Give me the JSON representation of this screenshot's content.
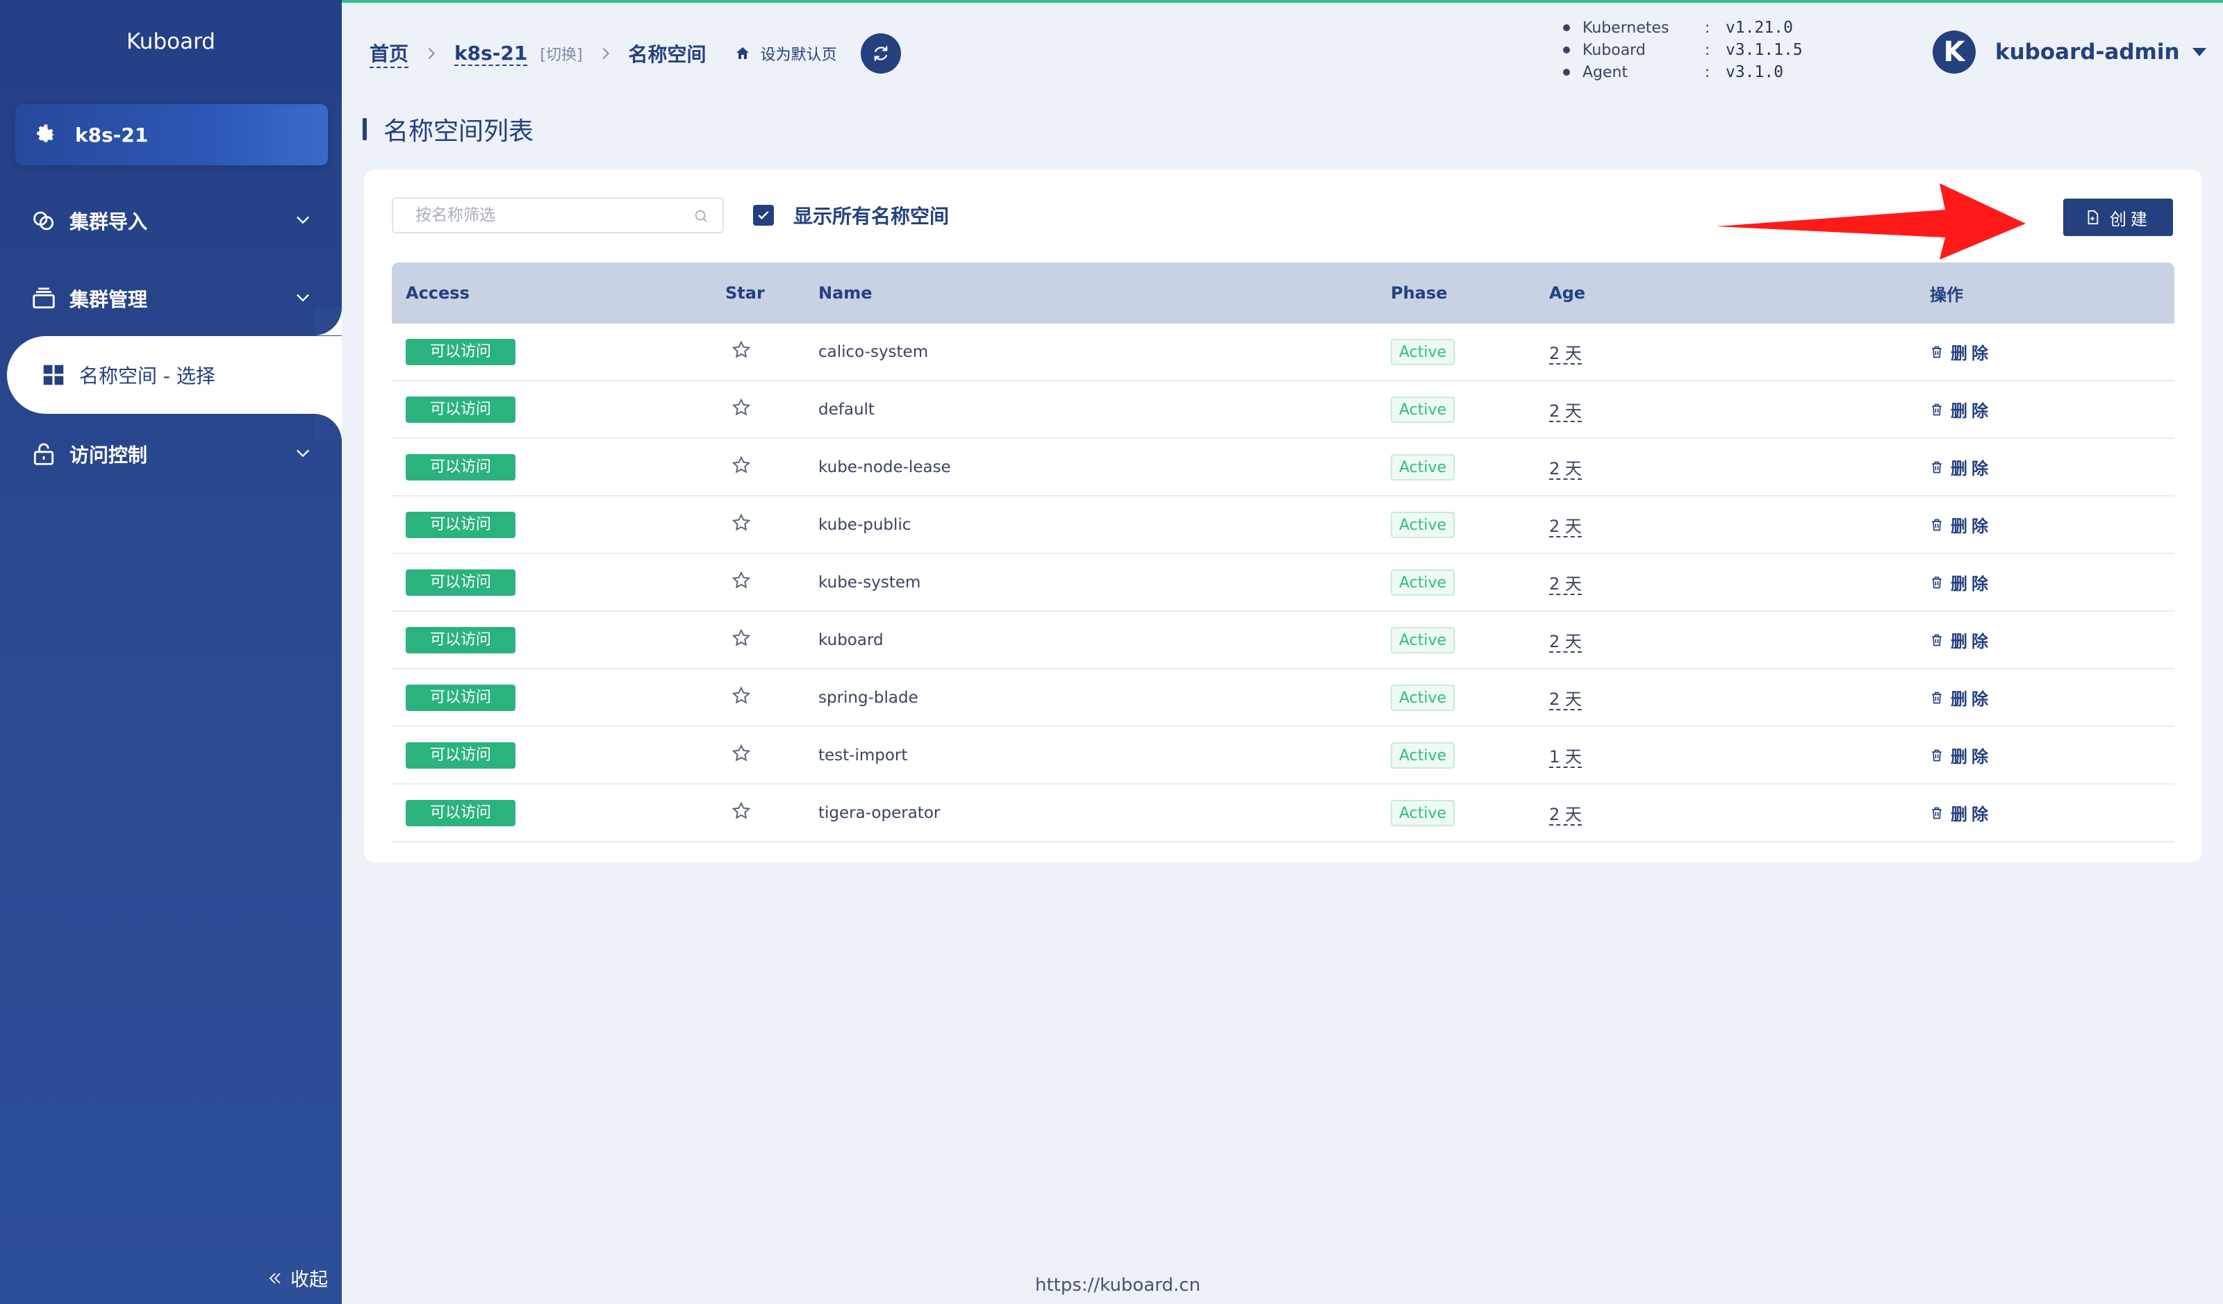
{
  "app": {
    "brand": "Kuboard"
  },
  "sidebar": {
    "cluster": "k8s-21",
    "items": [
      {
        "label": "集群导入",
        "icon": "cluster-import-icon"
      },
      {
        "label": "集群管理",
        "icon": "cluster-manage-icon"
      },
      {
        "label": "名称空间 - 选择",
        "icon": "grid-icon"
      },
      {
        "label": "访问控制",
        "icon": "lock-icon"
      }
    ],
    "collapse": "收起"
  },
  "breadcrumb": {
    "home": "首页",
    "cluster": "k8s-21",
    "switch": "[切换]",
    "current": "名称空间",
    "set_default": "设为默认页"
  },
  "versions": [
    {
      "name": "Kubernetes",
      "sep": ":",
      "value": "v1.21.0"
    },
    {
      "name": "Kuboard",
      "sep": ":",
      "value": "v3.1.1.5"
    },
    {
      "name": "Agent",
      "sep": ":",
      "value": "v3.1.0"
    }
  ],
  "user": {
    "initial": "K",
    "name": "kuboard-admin"
  },
  "page": {
    "title": "名称空间列表"
  },
  "toolbar": {
    "search_placeholder": "按名称筛选",
    "show_all_label": "显示所有名称空间",
    "create_label": "创建"
  },
  "table": {
    "headers": {
      "access": "Access",
      "star": "Star",
      "name": "Name",
      "phase": "Phase",
      "age": "Age",
      "ops": "操作"
    },
    "rows": [
      {
        "access": "可以访问",
        "name": "calico-system",
        "phase": "Active",
        "age": "2 天",
        "op": "删除"
      },
      {
        "access": "可以访问",
        "name": "default",
        "phase": "Active",
        "age": "2 天",
        "op": "删除"
      },
      {
        "access": "可以访问",
        "name": "kube-node-lease",
        "phase": "Active",
        "age": "2 天",
        "op": "删除"
      },
      {
        "access": "可以访问",
        "name": "kube-public",
        "phase": "Active",
        "age": "2 天",
        "op": "删除"
      },
      {
        "access": "可以访问",
        "name": "kube-system",
        "phase": "Active",
        "age": "2 天",
        "op": "删除"
      },
      {
        "access": "可以访问",
        "name": "kuboard",
        "phase": "Active",
        "age": "2 天",
        "op": "删除"
      },
      {
        "access": "可以访问",
        "name": "spring-blade",
        "phase": "Active",
        "age": "2 天",
        "op": "删除"
      },
      {
        "access": "可以访问",
        "name": "test-import",
        "phase": "Active",
        "age": "1 天",
        "op": "删除"
      },
      {
        "access": "可以访问",
        "name": "tigera-operator",
        "phase": "Active",
        "age": "2 天",
        "op": "删除"
      }
    ]
  },
  "footer": {
    "url": "https://kuboard.cn"
  },
  "colors": {
    "primary": "#24407f",
    "sidebar": "#2a4990",
    "success": "#2bb37e",
    "arrow": "#ff1a1a"
  }
}
